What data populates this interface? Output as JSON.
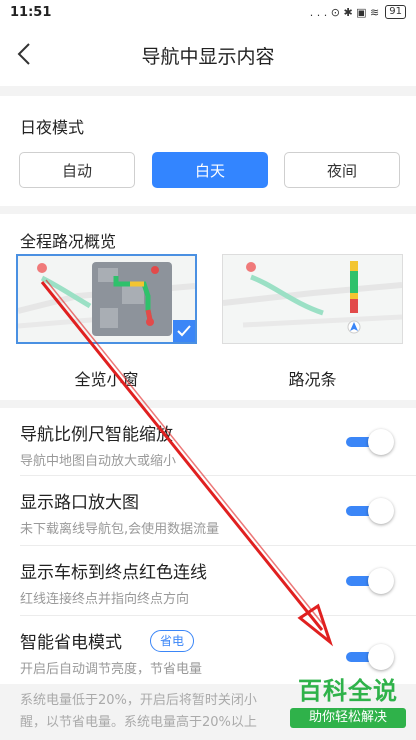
{
  "status_bar": {
    "time": "11:51",
    "icons": ". . . ⊙ ✱ ▣ ≋",
    "battery": "91"
  },
  "header": {
    "title": "导航中显示内容",
    "back_icon": "back-icon"
  },
  "day_night": {
    "title": "日夜模式",
    "options": [
      {
        "label": "自动",
        "active": false
      },
      {
        "label": "白天",
        "active": true
      },
      {
        "label": "夜间",
        "active": false
      }
    ]
  },
  "overview": {
    "title": "全程路况概览",
    "options": [
      {
        "label": "全览小窗",
        "selected": true
      },
      {
        "label": "路况条",
        "selected": false
      }
    ]
  },
  "settings": [
    {
      "title": "导航比例尺智能缩放",
      "subtitle": "导航中地图自动放大或缩小",
      "enabled": true
    },
    {
      "title": "显示路口放大图",
      "subtitle": "未下载离线导航包,会使用数据流量",
      "enabled": true
    },
    {
      "title": "显示车标到终点红色连线",
      "subtitle": "红线连接终点并指向终点方向",
      "enabled": true
    },
    {
      "title": "智能省电模式",
      "badge": "省电",
      "subtitle": "开启后自动调节亮度，节省电量",
      "enabled": true
    }
  ],
  "note": {
    "line1": "系统电量低于20%，开启后将暂时关闭小",
    "line2": "醒，以节省电量。系统电量高于20%以上"
  },
  "watermark": {
    "main": "百科全说",
    "sub": "助你轻松解决"
  },
  "colors": {
    "accent": "#3385ff",
    "toggle": "#3b86f7",
    "arrow": "#e02020",
    "watermark": "#2fb24a"
  }
}
